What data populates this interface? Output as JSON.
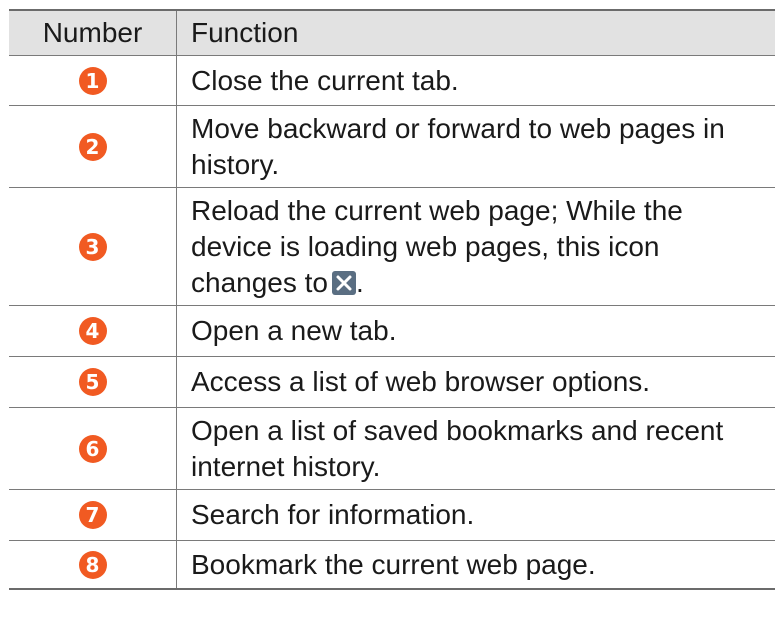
{
  "header": {
    "number": "Number",
    "function": "Function"
  },
  "rows": [
    {
      "number": "1",
      "function": "Close the current tab."
    },
    {
      "number": "2",
      "function": "Move backward or forward to web pages in history."
    },
    {
      "number": "3",
      "function": "Reload the current web page; While the device is loading web pages, this icon changes to",
      "function_suffix": "."
    },
    {
      "number": "4",
      "function": "Open a new tab."
    },
    {
      "number": "5",
      "function": "Access a list of web browser options."
    },
    {
      "number": "6",
      "function": "Open a list of saved bookmarks and recent internet history."
    },
    {
      "number": "7",
      "function": "Search for information."
    },
    {
      "number": "8",
      "function": "Bookmark the current web page."
    }
  ],
  "icons": {
    "stop_icon": "close-x-icon"
  },
  "colors": {
    "badge": "#f15a22",
    "header_bg": "#e2e2e2",
    "stop_icon_bg": "#5a6e82"
  }
}
